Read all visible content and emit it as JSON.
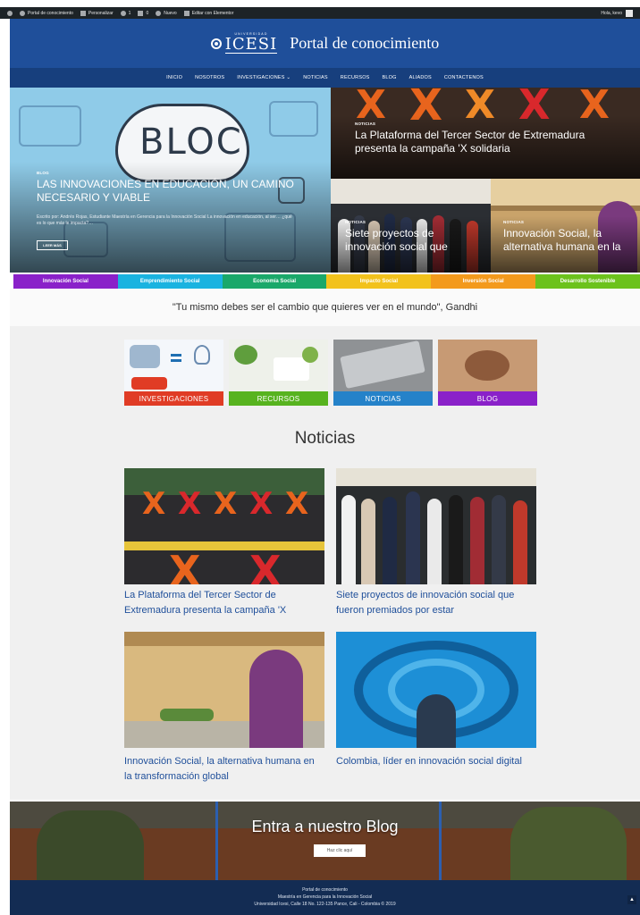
{
  "admin_bar": {
    "items": [
      "Portal de conocimiento",
      "Personalizar",
      "1",
      "0",
      "Nuevo",
      "Editar con Elementor"
    ],
    "greeting": "Hola, kevo"
  },
  "header": {
    "logo_sub": "UNIVERSIDAD",
    "logo_main": "ICESI",
    "site_title": "Portal de conocimiento"
  },
  "nav": {
    "items": [
      "INICIO",
      "NOSOTROS",
      "INVESTIGACIONES ⌄",
      "NOTICIAS",
      "RECURSOS",
      "BLOG",
      "ALIADOS",
      "CONTACTENOS"
    ]
  },
  "hero": {
    "main": {
      "category": "BLOG",
      "title": "LAS INNOVACIONES EN EDUCACIÓN, UN CAMINO NECESARIO Y VIABLE",
      "excerpt": "Escrito por: Andrés Rojas, Estudiante Maestría en Gerencia para la Innovación Social La innovación en educación, al ser… ¿qué es lo que más le impacta?…",
      "button": "LEER MÁS",
      "cloud_word": "BLOC"
    },
    "top_right": {
      "category": "NOTICIAS",
      "title": "La Plataforma del Tercer Sector de Extremadura presenta la campaña 'X solidaria"
    },
    "bottom_left": {
      "category": "NOTICIAS",
      "title": "Siete proyectos de innovación social que"
    },
    "bottom_right": {
      "category": "NOTICIAS",
      "title": "Innovación Social, la alternativa humana en la"
    }
  },
  "categories": [
    {
      "label": "Innovación Social",
      "color": "#8a21c9"
    },
    {
      "label": "Emprendimiento Social",
      "color": "#1ab3e0"
    },
    {
      "label": "Economía Social",
      "color": "#1aa86a"
    },
    {
      "label": "Impacto Social",
      "color": "#f2c21c"
    },
    {
      "label": "Inversión Social",
      "color": "#f39a1c"
    },
    {
      "label": "Desarrollo Sostenible",
      "color": "#6cc21c"
    }
  ],
  "quote": "\"Tu mismo debes ser el cambio que quieres ver en el mundo\", Gandhi",
  "quick_tiles": [
    {
      "label": "INVESTIGACIONES",
      "color": "#e03c25"
    },
    {
      "label": "RECURSOS",
      "color": "#57b31f"
    },
    {
      "label": "NOTICIAS",
      "color": "#2582c9"
    },
    {
      "label": "BLOG",
      "color": "#8a21c9"
    }
  ],
  "news": {
    "heading": "Noticias",
    "items": [
      {
        "title": "La Plataforma del Tercer Sector de Extremadura presenta la campaña 'X"
      },
      {
        "title": "Siete proyectos de innovación social que fueron premiados por estar"
      },
      {
        "title": "Innovación Social, la alternativa humana en la transformación global"
      },
      {
        "title": "Colombia, líder en innovación social digital"
      }
    ]
  },
  "blog_banner": {
    "title": "Entra a nuestro Blog",
    "button": "Haz clic aquí"
  },
  "footer": {
    "line1": "Portal de conocimiento",
    "line2": "Maestría en Gerencia para la Innovación Social",
    "line3": "Universidad Icesi, Calle 18 No. 122-135 Pance, Cali - Colombia © 2019"
  },
  "icons": [
    "wordpress-icon",
    "home-icon",
    "brush-icon",
    "refresh-icon",
    "comment-icon",
    "plus-icon",
    "elementor-icon",
    "arrow-up-icon"
  ]
}
